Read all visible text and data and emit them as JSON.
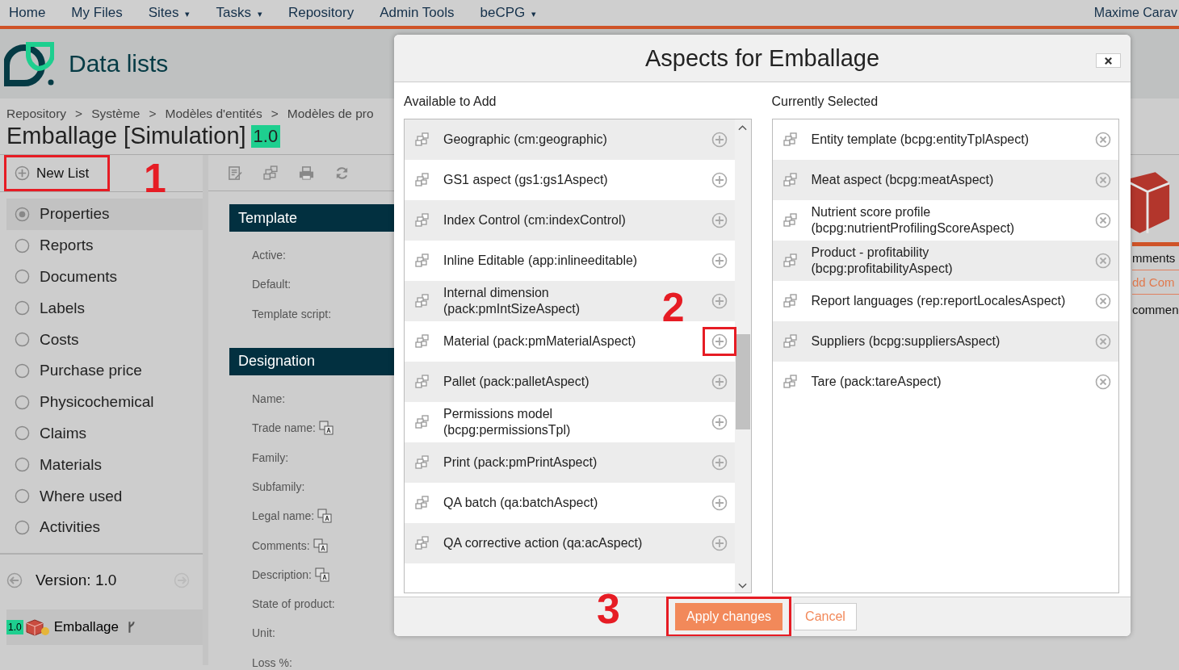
{
  "nav": {
    "items": [
      {
        "label": "Home",
        "dropdown": false
      },
      {
        "label": "My Files",
        "dropdown": false
      },
      {
        "label": "Sites",
        "dropdown": true
      },
      {
        "label": "Tasks",
        "dropdown": true
      },
      {
        "label": "Repository",
        "dropdown": false
      },
      {
        "label": "Admin Tools",
        "dropdown": false
      },
      {
        "label": "beCPG",
        "dropdown": true
      }
    ],
    "caret": "▾",
    "user": "Maxime Carav"
  },
  "header": {
    "title": "Data lists"
  },
  "breadcrumb": {
    "separator": ">",
    "items": [
      "Repository",
      "Système",
      "Modèles d'entités",
      "Modèles de pro"
    ]
  },
  "page_title": {
    "text": "Emballage [Simulation]",
    "version": "1.0"
  },
  "new_list": {
    "label": "New List",
    "highlighted": true,
    "annotation": "1"
  },
  "datalists": [
    {
      "label": "Properties",
      "selected": true
    },
    {
      "label": "Reports",
      "selected": false
    },
    {
      "label": "Documents",
      "selected": false
    },
    {
      "label": "Labels",
      "selected": false
    },
    {
      "label": "Costs",
      "selected": false
    },
    {
      "label": "Purchase price",
      "selected": false
    },
    {
      "label": "Physicochemical",
      "selected": false
    },
    {
      "label": "Claims",
      "selected": false
    },
    {
      "label": "Materials",
      "selected": false
    },
    {
      "label": "Where used",
      "selected": false
    },
    {
      "label": "Activities",
      "selected": false
    }
  ],
  "version": {
    "label": "Version: 1.0"
  },
  "entity": {
    "badge": "1.0",
    "name": "Emballage"
  },
  "sections": [
    {
      "title": "Template",
      "fields": [
        {
          "label": "Active:",
          "translatable": false
        },
        {
          "label": "Default:",
          "translatable": false
        },
        {
          "label": "Template script:",
          "translatable": false
        }
      ]
    },
    {
      "title": "Designation",
      "fields": [
        {
          "label": "Name:",
          "translatable": false
        },
        {
          "label": "Trade name:",
          "translatable": true
        },
        {
          "label": "Family:",
          "translatable": false
        },
        {
          "label": "Subfamily:",
          "translatable": false
        },
        {
          "label": "Legal name:",
          "translatable": true
        },
        {
          "label": "Comments:",
          "translatable": true
        },
        {
          "label": "Description:",
          "translatable": true
        },
        {
          "label": "State of product:",
          "translatable": false
        },
        {
          "label": "Unit:",
          "translatable": false
        },
        {
          "label": "Loss %:",
          "translatable": false
        }
      ]
    }
  ],
  "comments_panel": {
    "title": "mments",
    "add_link": "dd Com",
    "text": "commen"
  },
  "dialog": {
    "title": "Aspects for Emballage",
    "available_title": "Available to Add",
    "selected_title": "Currently Selected",
    "available": [
      {
        "label": "Geographic (cm:geographic)",
        "highlighted": false
      },
      {
        "label": "GS1 aspect (gs1:gs1Aspect)",
        "highlighted": false
      },
      {
        "label": "Index Control (cm:indexControl)",
        "highlighted": false
      },
      {
        "label": "Inline Editable (app:inlineeditable)",
        "highlighted": false
      },
      {
        "label": "Internal dimension (pack:pmIntSizeAspect)",
        "highlighted": false,
        "annotation": "2"
      },
      {
        "label": "Material (pack:pmMaterialAspect)",
        "highlighted": true
      },
      {
        "label": "Pallet (pack:palletAspect)",
        "highlighted": false
      },
      {
        "label": "Permissions model (bcpg:permissionsTpl)",
        "highlighted": false
      },
      {
        "label": "Print (pack:pmPrintAspect)",
        "highlighted": false
      },
      {
        "label": "QA batch (qa:batchAspect)",
        "highlighted": false
      },
      {
        "label": "QA corrective action (qa:acAspect)",
        "highlighted": false
      }
    ],
    "selected": [
      {
        "label": "Entity template (bcpg:entityTplAspect)"
      },
      {
        "label": "Meat aspect (bcpg:meatAspect)"
      },
      {
        "label": "Nutrient score profile (bcpg:nutrientProfilingScoreAspect)"
      },
      {
        "label": "Product - profitability (bcpg:profitabilityAspect)"
      },
      {
        "label": "Report languages (rep:reportLocalesAspect)"
      },
      {
        "label": "Suppliers (bcpg:suppliersAspect)"
      },
      {
        "label": "Tare (pack:tareAspect)"
      }
    ],
    "apply": {
      "label": "Apply changes",
      "highlighted": true,
      "annotation": "3"
    },
    "cancel": {
      "label": "Cancel"
    }
  }
}
